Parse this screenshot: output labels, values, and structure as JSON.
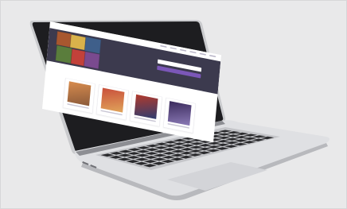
{
  "site": {
    "logo_text": "",
    "hero_heading": "",
    "section_title": ""
  },
  "colors": {
    "background": "#e9e9ea",
    "laptop_body": "#dcdde0",
    "laptop_bezel": "#1d1d20",
    "hero_bg": "#3c3a4e",
    "accent_button": "#7b57b8",
    "keys": "#2a2a2d"
  },
  "icons": {
    "laptop": "laptop-icon"
  }
}
